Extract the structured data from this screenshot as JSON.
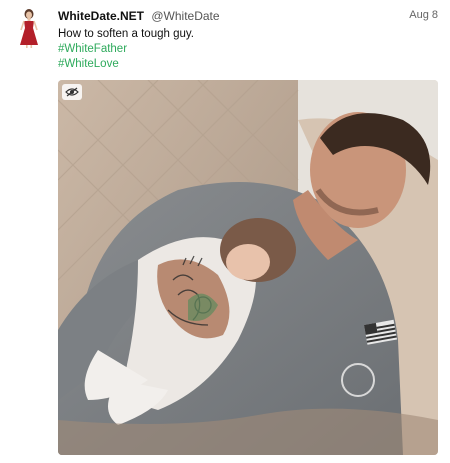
{
  "tweet": {
    "display_name": "WhiteDate.NET",
    "handle": "@WhiteDate",
    "date": "Aug 8",
    "text": "How to soften a tough guy.",
    "hashtags": [
      "#WhiteFather",
      "#WhiteLove"
    ],
    "hashtag_color": "#2eaa5c",
    "avatar_icon": "woman-in-red-dress-icon",
    "media": {
      "type": "photo",
      "badge_icon": "eye-slash-icon"
    }
  }
}
